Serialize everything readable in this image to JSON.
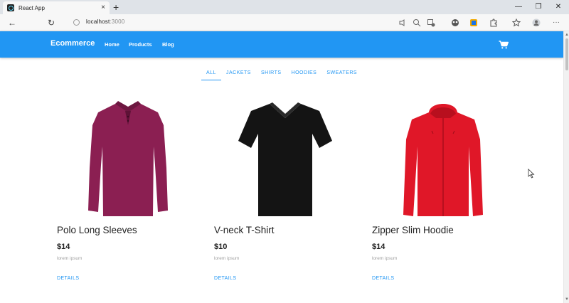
{
  "browser": {
    "tab_title": "React App",
    "tab_close": "×",
    "new_tab": "+",
    "win_minimize": "—",
    "win_maximize": "❐",
    "win_close": "✕",
    "back": "←",
    "reload": "↻",
    "url_host": "localhost",
    "url_port": ":3000",
    "more": "···"
  },
  "navbar": {
    "brand": "Ecommerce",
    "links": [
      "Home",
      "Products",
      "Blog"
    ],
    "color": "#2196f3"
  },
  "categories": {
    "items": [
      "ALL",
      "JACKETS",
      "SHIRTS",
      "HOODIES",
      "SWEATERS"
    ],
    "active": "ALL"
  },
  "products": [
    {
      "title": "Polo Long Sleeves",
      "price": "$14",
      "description": "lorem ipsum",
      "button": "DETAILS",
      "color": "#8b1f52"
    },
    {
      "title": "V-neck T-Shirt",
      "price": "$10",
      "description": "lorem ipsum",
      "button": "DETAILS",
      "color": "#141414"
    },
    {
      "title": "Zipper Slim Hoodie",
      "price": "$14",
      "description": "lorem ipsum",
      "button": "DETAILS",
      "color": "#e01728"
    }
  ]
}
